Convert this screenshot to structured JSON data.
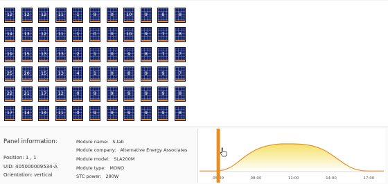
{
  "panel_grid": {
    "rows": [
      [
        "12",
        "12",
        "12",
        "11",
        "1",
        "9",
        "0",
        "10",
        "9",
        "8",
        "8"
      ],
      [
        "14",
        "13",
        "12",
        "11",
        "1",
        "0",
        "0",
        "10",
        "9",
        "7",
        "8"
      ],
      [
        "19",
        "15",
        "13",
        "13",
        "2",
        "1",
        "0",
        "9",
        "8",
        "7",
        "7"
      ],
      [
        "25",
        "20",
        "15",
        "13",
        "4",
        "1",
        "0",
        "8",
        "9",
        "9",
        "7"
      ],
      [
        "22",
        "21",
        "17",
        "12",
        "0",
        "9",
        "9",
        "9",
        "9",
        "9",
        "8"
      ],
      [
        "17",
        "14",
        "14",
        "11",
        "0",
        "9",
        "9",
        "9",
        "9",
        "9",
        "8"
      ]
    ],
    "colors": {
      "panel": "#15236b",
      "indicator": "#e98e27"
    }
  },
  "panel_info": {
    "title": "Panel information:",
    "position": "Position:  1 , 1",
    "uid": "UID:  405000009534-A",
    "orientation": "Orientation:  vertical"
  },
  "module_info": {
    "name_label": "Module name:",
    "name_value": "S-lab",
    "company_label": "Module company:",
    "company_value": "Alternative Energy Associates",
    "model_label": "Module model:",
    "model_value": "SLA200M",
    "type_label": "Module type:",
    "type_value": "MONO",
    "power_label": "STC power:",
    "power_value": "280W"
  },
  "chart_data": {
    "type": "area",
    "x_tick_labels": [
      "05:00",
      "08:00",
      "11:00",
      "14:00",
      "17:00"
    ],
    "x_range_hours": [
      3.5,
      18.2
    ],
    "series": [
      {
        "x": [
          3.5,
          4.8,
          5.5,
          6.0,
          6.5,
          7.0,
          7.5,
          8.0,
          8.5,
          9.0,
          9.5,
          10.0,
          10.5,
          11.0,
          11.5,
          12.0,
          12.5,
          13.0,
          13.5,
          14.0,
          14.5,
          15.0,
          15.5,
          16.0,
          16.5,
          17.0,
          18.2
        ],
        "y": [
          0.02,
          0.02,
          0.06,
          0.16,
          0.32,
          0.5,
          0.66,
          0.79,
          0.88,
          0.94,
          0.98,
          1.0,
          1.0,
          1.0,
          0.99,
          0.97,
          0.93,
          0.86,
          0.76,
          0.62,
          0.46,
          0.3,
          0.16,
          0.07,
          0.03,
          0.02,
          0.02
        ]
      }
    ],
    "cursor_time_hours": 5.0,
    "colors": {
      "line": "#e98e27",
      "fill_top": "#f5e16a",
      "fill_bottom": "#ffffff",
      "cursor": "#e98e27"
    },
    "grid": false
  }
}
